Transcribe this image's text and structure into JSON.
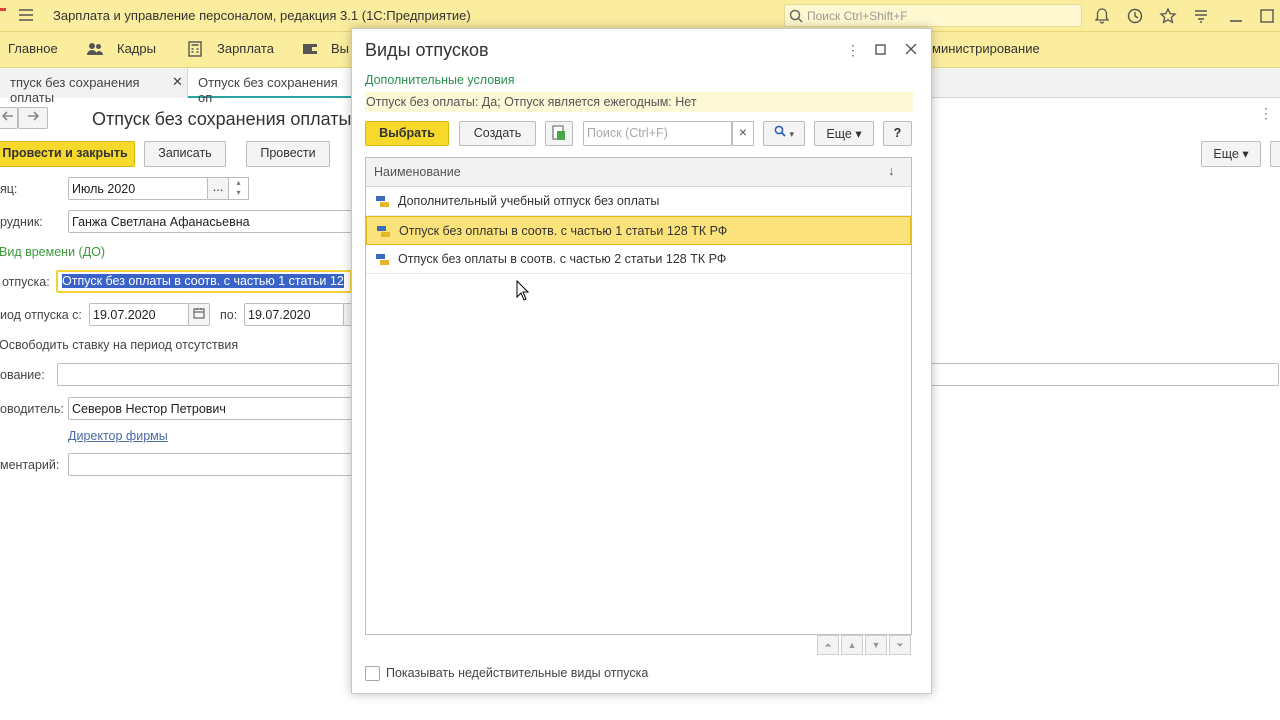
{
  "window": {
    "title": "Зарплата и управление персоналом, редакция 3.1  (1С:Предприятие)",
    "search_placeholder": "Поиск Ctrl+Shift+F"
  },
  "sections": [
    "Главное",
    "Кадры",
    "Зарплата",
    "Вы",
    "министрирование"
  ],
  "tabs": [
    "тпуск без сохранения оплаты",
    "Отпуск без сохранения оп"
  ],
  "form": {
    "title": "Отпуск без сохранения оплаты",
    "btn_post_close": "Провести и закрыть",
    "btn_write": "Записать",
    "btn_post": "Провести",
    "btn_more": "Еще",
    "month_label": "яц:",
    "month_value": "Июль 2020",
    "employee_label": "рудник:",
    "employee_value": "Ганжа Светлана Афанасьевна",
    "time_type_link": "Вид времени (ДО)",
    "vacation_label": "отпуска:",
    "vacation_value": "Отпуск без оплаты в соотв. с частью 1 статьи 12",
    "period_label": "иод отпуска с:",
    "period_from": "19.07.2020",
    "period_to_label": "по:",
    "period_to": "19.07.2020",
    "free_rate_label": "Освободить ставку на период отсутствия",
    "basis_label": "ование:",
    "head_label": "оводитель:",
    "head_value": "Северов Нестор Петрович",
    "head_position": "Директор фирмы",
    "comment_label": "ментарий:"
  },
  "dialog": {
    "title": "Виды отпусков",
    "extra_conditions_label": "Дополнительные условия",
    "extra_conditions_text": "Отпуск без оплаты: Да; Отпуск является ежегодным: Нет",
    "btn_select": "Выбрать",
    "btn_create": "Создать",
    "search_placeholder": "Поиск (Ctrl+F)",
    "search_clear": "×",
    "btn_more": "Еще",
    "btn_help": "?",
    "column_header": "Наименование",
    "sort_indicator": "↓",
    "rows": [
      "Дополнительный учебный отпуск без оплаты",
      "Отпуск без оплаты в соотв. с частью 1 статьи 128 ТК РФ",
      "Отпуск без оплаты в соотв. с частью 2 статьи 128 ТК РФ"
    ],
    "selected_row_index": 1,
    "show_invalid_label": "Показывать недействительные виды отпуска",
    "show_invalid_checked": false
  },
  "colors": {
    "accent_yellow": "#fbed9e",
    "button_yellow": "#f7d92c",
    "selection": "#fbe27a",
    "link_green": "#3a9a3a"
  }
}
